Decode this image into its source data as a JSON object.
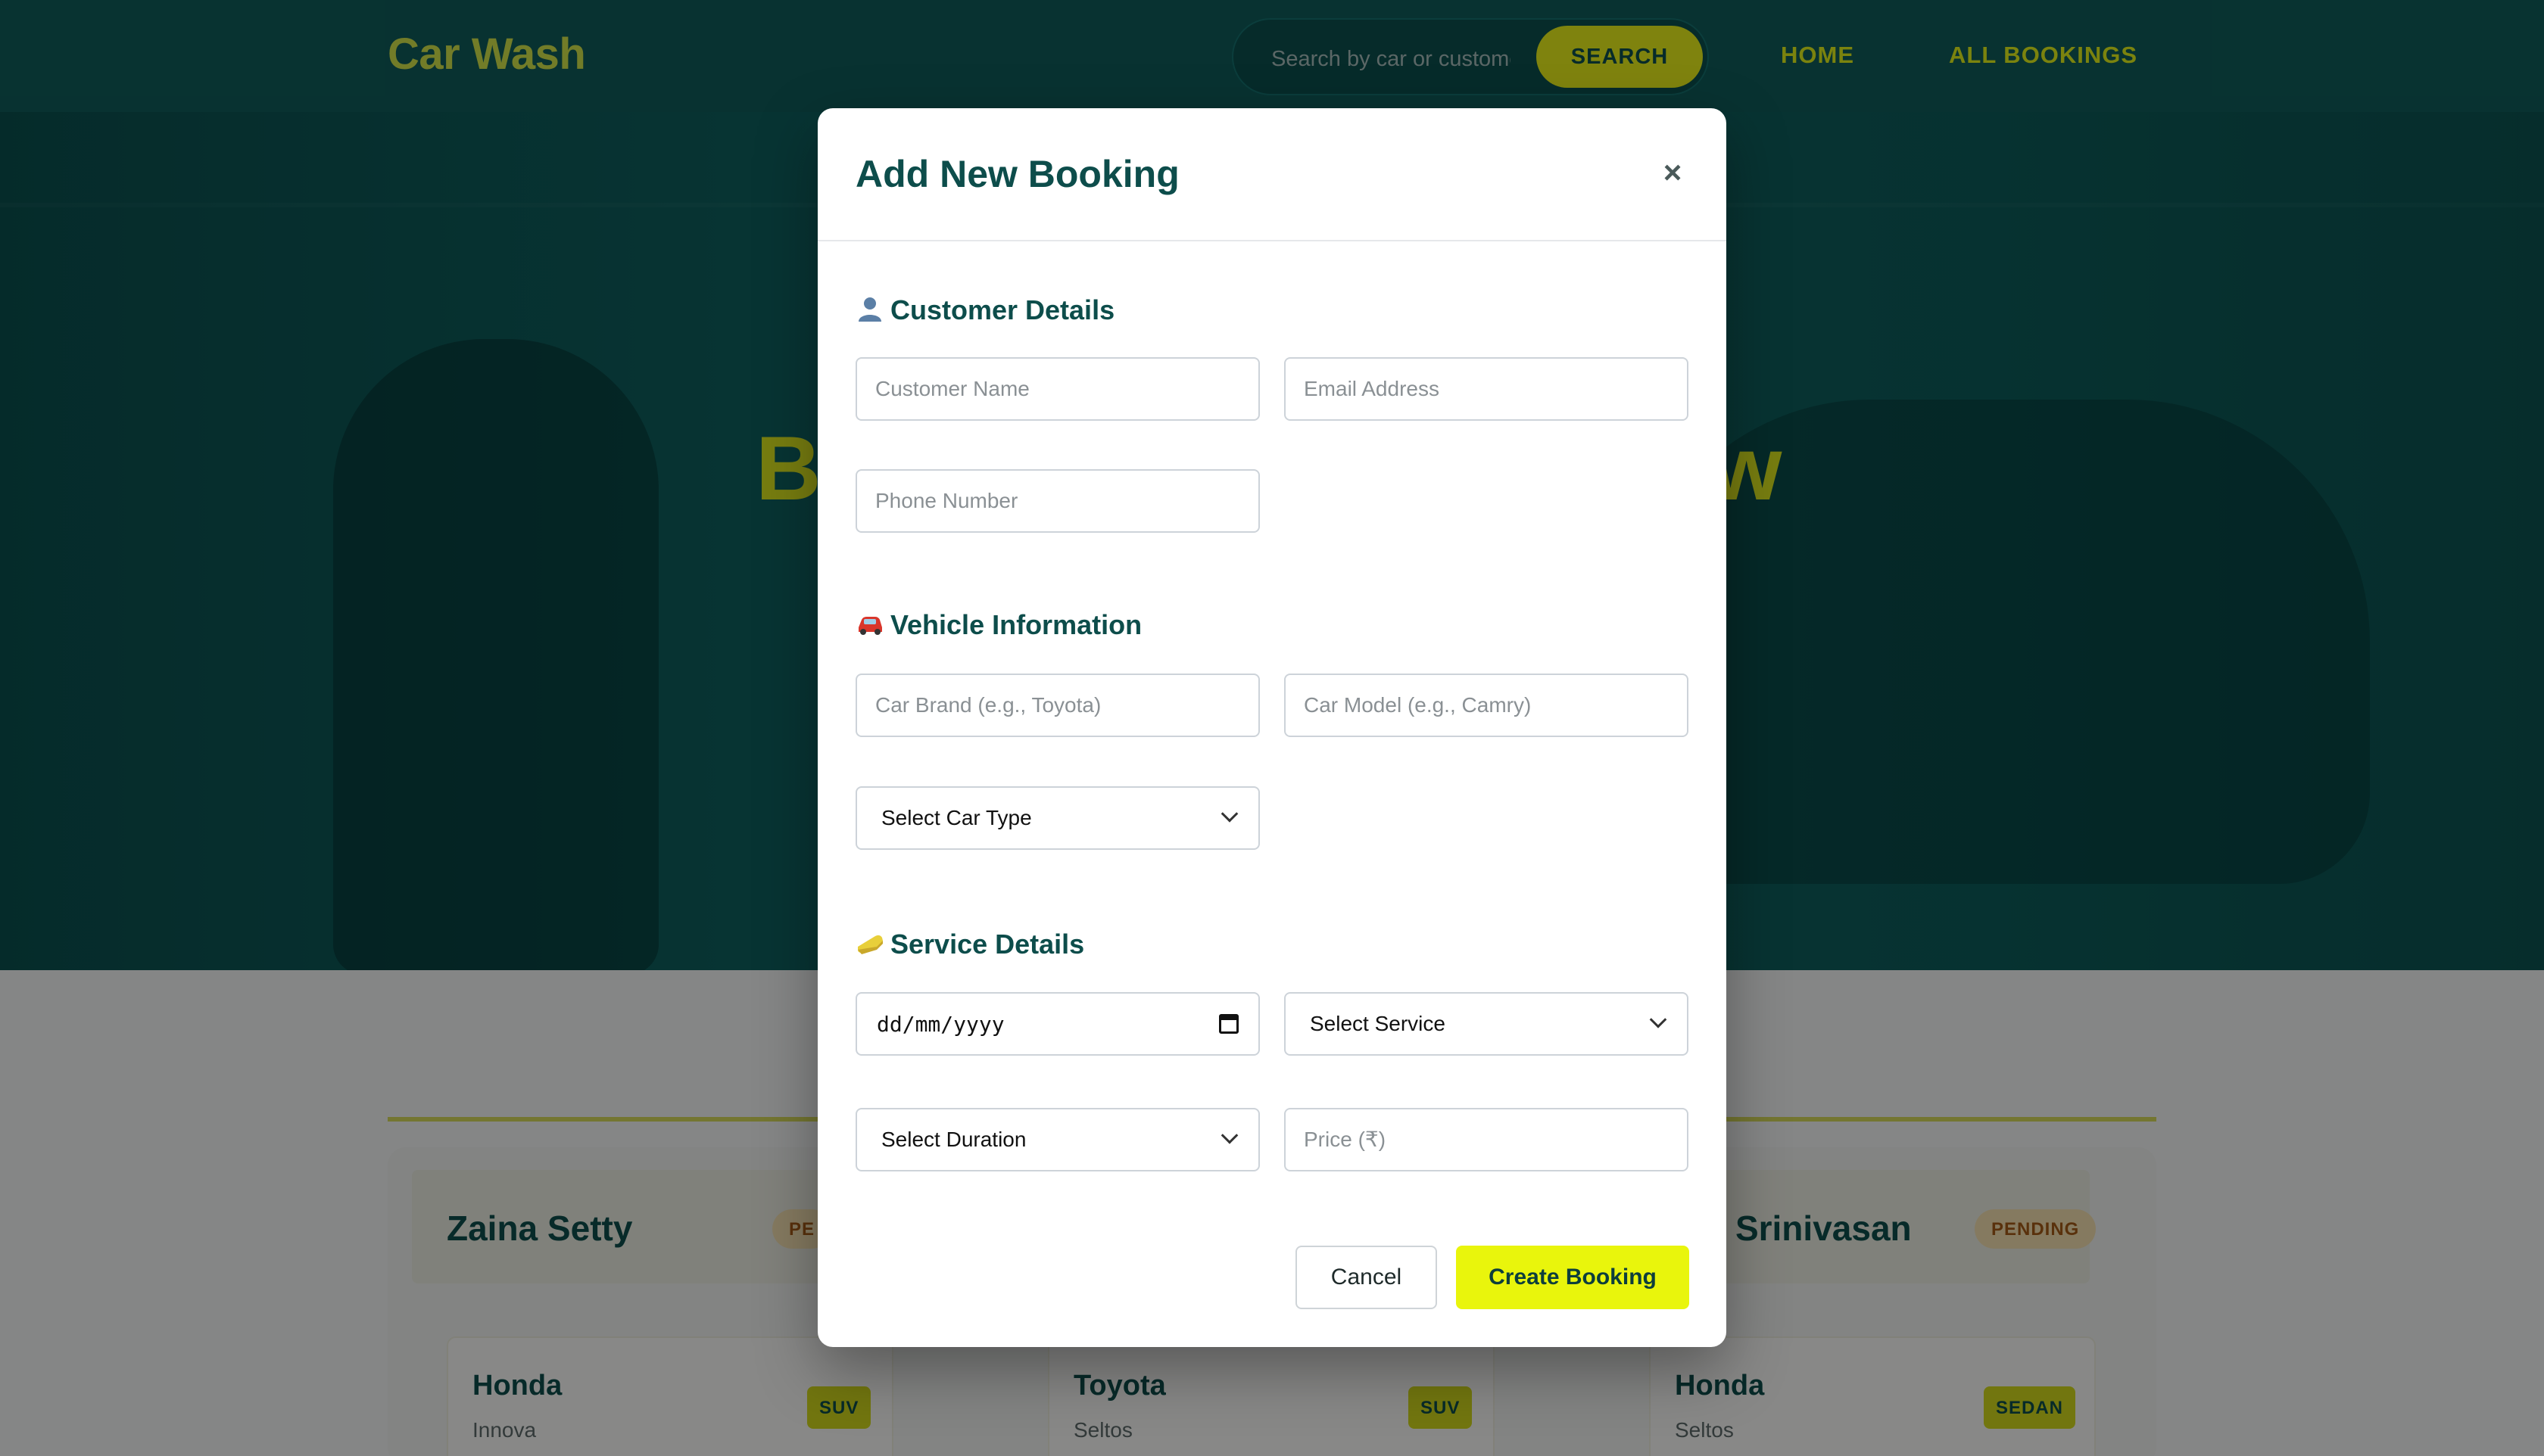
{
  "nav": {
    "brand": "Car Wash",
    "search_placeholder": "Search by car or customer",
    "search_label": "SEARCH",
    "home_label": "HOME",
    "all_bookings_label": "ALL BOOKINGS"
  },
  "hero": {
    "title_left": "B",
    "title_right": "w"
  },
  "bookings": [
    {
      "name": "Zaina Setty",
      "status": "PE",
      "car_brand": "Honda",
      "car_model": "Innova",
      "car_type": "SUV"
    },
    {
      "name": "",
      "status": "",
      "car_brand": "Toyota",
      "car_model": "Seltos",
      "car_type": "SUV"
    },
    {
      "name": "ya Srinivasan",
      "status": "PENDING",
      "car_brand": "Honda",
      "car_model": "Seltos",
      "car_type": "SEDAN"
    }
  ],
  "modal": {
    "title": "Add New Booking",
    "close_label": "×",
    "sections": {
      "customer": "Customer Details",
      "vehicle": "Vehicle Information",
      "service": "Service Details"
    },
    "fields": {
      "customer_name_ph": "Customer Name",
      "email_ph": "Email Address",
      "phone_ph": "Phone Number",
      "car_brand_ph": "Car Brand (e.g., Toyota)",
      "car_model_ph": "Car Model (e.g., Camry)",
      "car_type_selected": "Select Car Type",
      "date_value": "dd/mm/yyyy",
      "service_selected": "Select Service",
      "duration_selected": "Select Duration",
      "price_ph": "Price (₹)"
    },
    "cancel_label": "Cancel",
    "create_label": "Create Booking"
  },
  "icons": {
    "customer": "person-icon",
    "vehicle": "car-icon",
    "service": "sponge-icon"
  },
  "colors": {
    "teal_dark": "#0f5c5a",
    "accent_yellow": "#e9f50c",
    "heading_teal": "#0d4d4b"
  }
}
